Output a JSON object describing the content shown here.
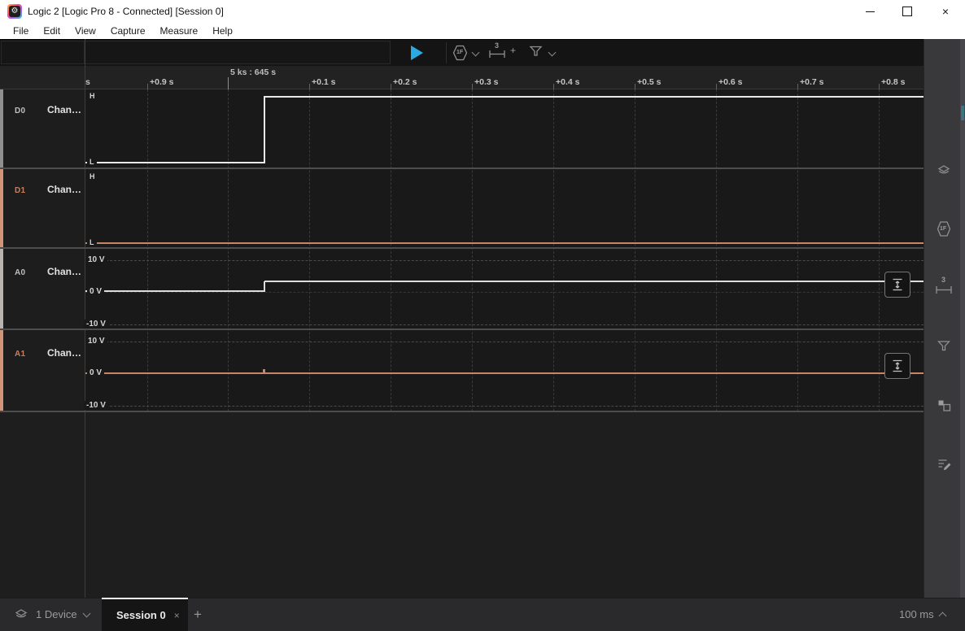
{
  "window": {
    "title": "Logic 2 [Logic Pro 8 - Connected] [Session 0]",
    "close_glyph": "×"
  },
  "menu": {
    "items": [
      "File",
      "Edit",
      "View",
      "Capture",
      "Measure",
      "Help"
    ]
  },
  "toolbar": {
    "analyzer_badge": "1F",
    "measure_badge": "3",
    "measure_add": "+"
  },
  "timeline": {
    "major_label": "5 ks : 645 s",
    "tick_labels": [
      "s",
      "+0.9 s",
      "+0.1 s",
      "+0.2 s",
      "+0.3 s",
      "+0.4 s",
      "+0.5 s",
      "+0.6 s",
      "+0.7 s",
      "+0.8 s"
    ]
  },
  "channels": [
    {
      "id": "D0",
      "name": "Chan…",
      "type": "digital",
      "high_label": "H",
      "low_label": "L",
      "color": "#e8e8e8",
      "signal": "low until ≈645.05 s, then high"
    },
    {
      "id": "D1",
      "name": "Chan…",
      "type": "digital",
      "high_label": "H",
      "low_label": "L",
      "color": "#c5876a",
      "signal": "low for entire visible range"
    },
    {
      "id": "A0",
      "name": "Chan…",
      "type": "analog",
      "scale_labels": [
        "10 V",
        "0 V",
        "-10 V"
      ],
      "color": "#dcdcdc",
      "signal": "≈0 V until ≈645.05 s, then ≈3 V"
    },
    {
      "id": "A1",
      "name": "Chan…",
      "type": "analog",
      "scale_labels": [
        "10 V",
        "0 V",
        "-10 V"
      ],
      "color": "#c5876a",
      "signal": "≈0 V for entire visible range, tiny glitch at ≈645.05 s"
    }
  ],
  "sidebar": {
    "analyzer_badge": "1F",
    "measure_badge": "3"
  },
  "bottom_bar": {
    "device_label": "1 Device",
    "session_tab_label": "Session 0",
    "close_tab_glyph": "×",
    "new_tab_glyph": "+",
    "timescale": "100 ms"
  }
}
